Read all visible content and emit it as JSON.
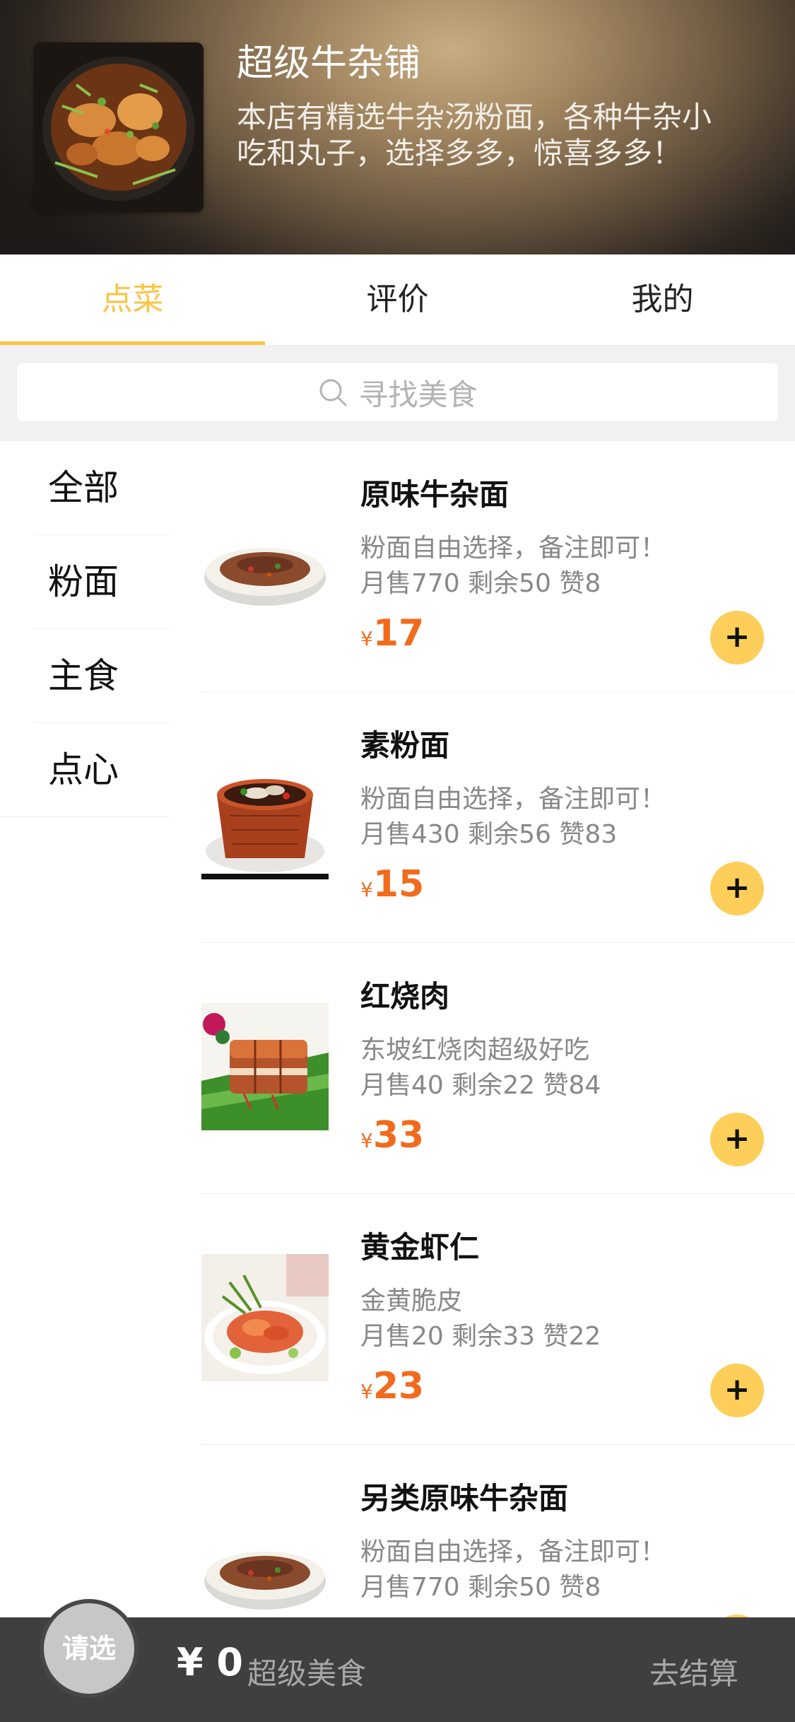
{
  "header": {
    "shop_name": "超级牛杂铺",
    "description": "本店有精选牛杂汤粉面，各种牛杂小吃和丸子，选择多多，惊喜多多！"
  },
  "tabs": [
    {
      "label": "点菜",
      "active": true
    },
    {
      "label": "评价",
      "active": false
    },
    {
      "label": "我的",
      "active": false
    }
  ],
  "search": {
    "placeholder": "寻找美食",
    "icon": "search-icon"
  },
  "categories": [
    "全部",
    "粉面",
    "主食",
    "点心"
  ],
  "products": [
    {
      "name": "原味牛杂面",
      "desc": "粉面自由选择，备注即可！",
      "stats": "月售770 剩余50 赞8",
      "currency": "¥",
      "price": "17",
      "image": "noodle-bowl",
      "add_label": "+"
    },
    {
      "name": "素粉面",
      "desc": "粉面自由选择，备注即可！",
      "stats": "月售430 剩余56 赞83",
      "currency": "¥",
      "price": "15",
      "image": "clay-pot",
      "add_label": "+"
    },
    {
      "name": "红烧肉",
      "desc": "东坡红烧肉超级好吃",
      "stats": "月售40 剩余22 赞84",
      "currency": "¥",
      "price": "33",
      "image": "braised-pork",
      "add_label": "+"
    },
    {
      "name": "黄金虾仁",
      "desc": "金黄脆皮",
      "stats": "月售20 剩余33 赞22",
      "currency": "¥",
      "price": "23",
      "image": "golden-shrimp",
      "add_label": "+"
    },
    {
      "name": "另类原味牛杂面",
      "desc": "粉面自由选择，备注即可！",
      "stats": "月售770 剩余50 赞8",
      "currency": "¥",
      "price": "",
      "image": "noodle-bowl",
      "add_label": "+"
    }
  ],
  "cart": {
    "select_label": "请选",
    "total": "¥ 0",
    "label": "超级美食",
    "checkout_label": "去结算"
  },
  "colors": {
    "accent": "#f9c544",
    "price": "#f26b1d",
    "add_button": "#fdcf5a",
    "bottom_bar": "#3f3f3f"
  }
}
